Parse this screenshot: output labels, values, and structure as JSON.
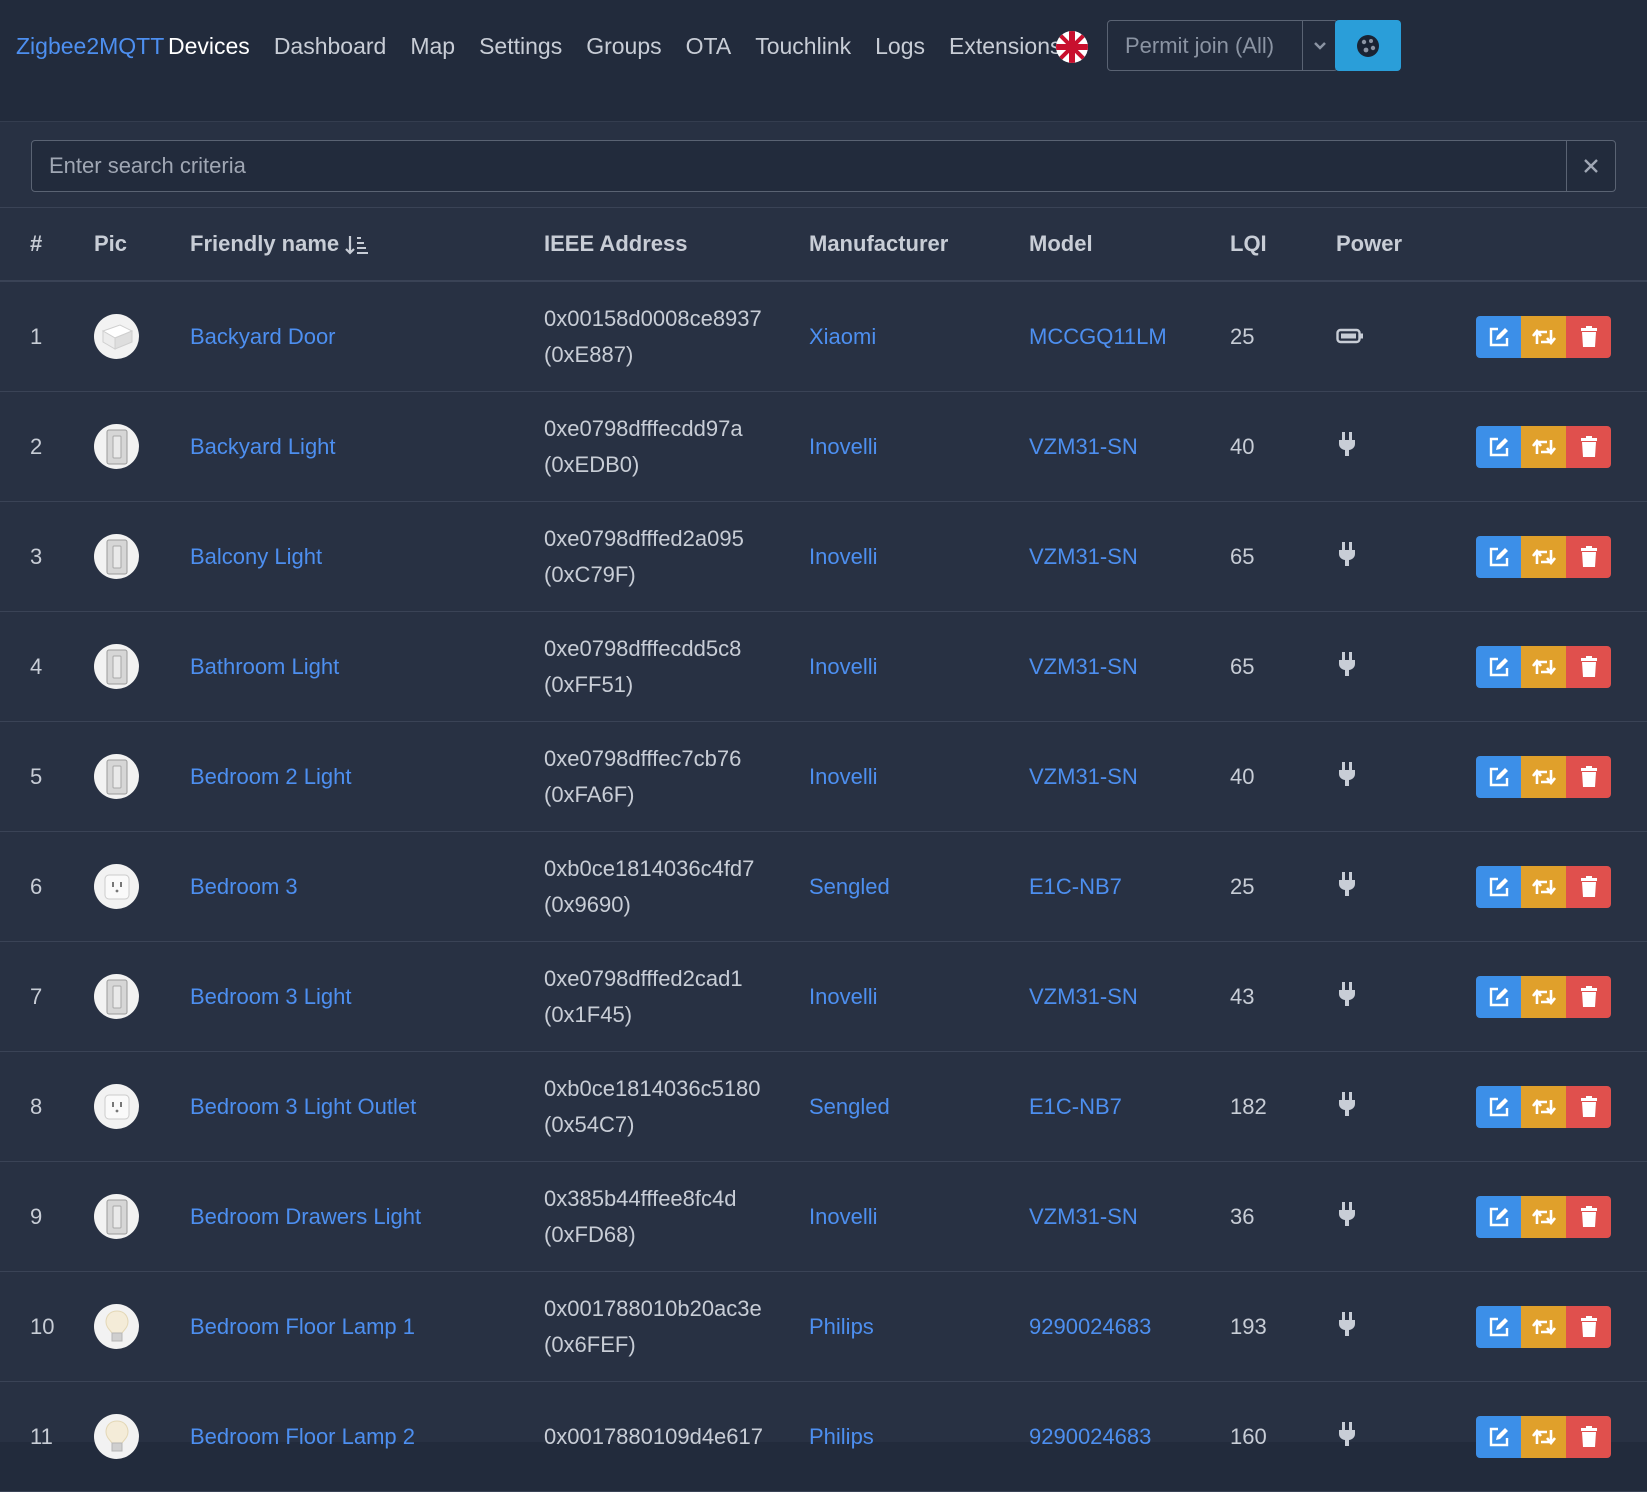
{
  "navbar": {
    "brand": "Zigbee2MQTT",
    "links": [
      "Devices",
      "Dashboard",
      "Map",
      "Settings",
      "Groups",
      "OTA",
      "Touchlink",
      "Logs",
      "Extensions"
    ],
    "active": "Devices",
    "permit_join_label": "Permit join (All)",
    "language_icon": "uk-flag-icon",
    "reset_icon": "globe-icon"
  },
  "search": {
    "placeholder": "Enter search criteria",
    "value": ""
  },
  "table": {
    "headers": {
      "num": "#",
      "pic": "Pic",
      "friendly_name": "Friendly name",
      "ieee": "IEEE Address",
      "manufacturer": "Manufacturer",
      "model": "Model",
      "lqi": "LQI",
      "power": "Power"
    },
    "sort_icon": "sort-alpha-down-icon",
    "rows": [
      {
        "num": "1",
        "name": "Backyard Door",
        "ieee": "0x00158d0008ce8937",
        "nwk": "(0xE887)",
        "manufacturer": "Xiaomi",
        "model": "MCCGQ11LM",
        "lqi": "25",
        "power": "battery-icon",
        "pic": "door-sensor-icon"
      },
      {
        "num": "2",
        "name": "Backyard Light",
        "ieee": "0xe0798dfffecdd97a",
        "nwk": "(0xEDB0)",
        "manufacturer": "Inovelli",
        "model": "VZM31-SN",
        "lqi": "40",
        "power": "plug-icon",
        "pic": "switch-icon"
      },
      {
        "num": "3",
        "name": "Balcony Light",
        "ieee": "0xe0798dfffed2a095",
        "nwk": "(0xC79F)",
        "manufacturer": "Inovelli",
        "model": "VZM31-SN",
        "lqi": "65",
        "power": "plug-icon",
        "pic": "switch-icon"
      },
      {
        "num": "4",
        "name": "Bathroom Light",
        "ieee": "0xe0798dfffecdd5c8",
        "nwk": "(0xFF51)",
        "manufacturer": "Inovelli",
        "model": "VZM31-SN",
        "lqi": "65",
        "power": "plug-icon",
        "pic": "switch-icon"
      },
      {
        "num": "5",
        "name": "Bedroom 2 Light",
        "ieee": "0xe0798dfffec7cb76",
        "nwk": "(0xFA6F)",
        "manufacturer": "Inovelli",
        "model": "VZM31-SN",
        "lqi": "40",
        "power": "plug-icon",
        "pic": "switch-icon"
      },
      {
        "num": "6",
        "name": "Bedroom 3",
        "ieee": "0xb0ce1814036c4fd7",
        "nwk": "(0x9690)",
        "manufacturer": "Sengled",
        "model": "E1C-NB7",
        "lqi": "25",
        "power": "plug-icon",
        "pic": "outlet-icon"
      },
      {
        "num": "7",
        "name": "Bedroom 3 Light",
        "ieee": "0xe0798dfffed2cad1",
        "nwk": "(0x1F45)",
        "manufacturer": "Inovelli",
        "model": "VZM31-SN",
        "lqi": "43",
        "power": "plug-icon",
        "pic": "switch-icon"
      },
      {
        "num": "8",
        "name": "Bedroom 3 Light Outlet",
        "ieee": "0xb0ce1814036c5180",
        "nwk": "(0x54C7)",
        "manufacturer": "Sengled",
        "model": "E1C-NB7",
        "lqi": "182",
        "power": "plug-icon",
        "pic": "outlet-icon"
      },
      {
        "num": "9",
        "name": "Bedroom Drawers Light",
        "ieee": "0x385b44fffee8fc4d",
        "nwk": "(0xFD68)",
        "manufacturer": "Inovelli",
        "model": "VZM31-SN",
        "lqi": "36",
        "power": "plug-icon",
        "pic": "switch-icon"
      },
      {
        "num": "10",
        "name": "Bedroom Floor Lamp 1",
        "ieee": "0x001788010b20ac3e",
        "nwk": "(0x6FEF)",
        "manufacturer": "Philips",
        "model": "9290024683",
        "lqi": "193",
        "power": "plug-icon",
        "pic": "bulb-icon"
      },
      {
        "num": "11",
        "name": "Bedroom Floor Lamp 2",
        "ieee": "0x0017880109d4e617",
        "nwk": "",
        "manufacturer": "Philips",
        "model": "9290024683",
        "lqi": "160",
        "power": "plug-icon",
        "pic": "bulb-icon"
      }
    ],
    "row_actions": [
      "edit-icon",
      "rename-icon",
      "trash-icon"
    ]
  },
  "colors": {
    "background": "#222b3c",
    "card": "#283143",
    "link": "#4d8ff0",
    "edit": "#3c8fe8",
    "rename": "#e0a02b",
    "remove": "#e0504d",
    "reset": "#2a9ed9"
  }
}
